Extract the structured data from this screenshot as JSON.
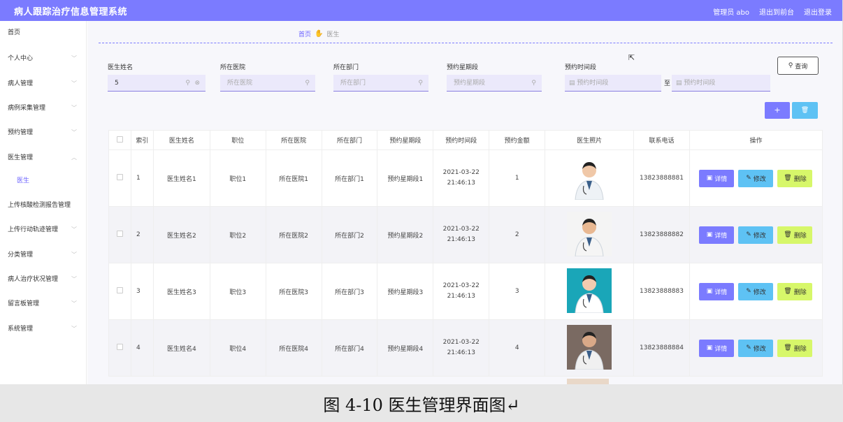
{
  "app_title": "病人跟踪治疗信息管理系统",
  "header_links": [
    "管理员 abo",
    "退出到前台",
    "退出登录"
  ],
  "sidebar": [
    {
      "label": "首页",
      "chevron": false
    },
    {
      "label": "个人中心",
      "chevron": true
    },
    {
      "label": "病人管理",
      "chevron": true
    },
    {
      "label": "病例采集管理",
      "chevron": true
    },
    {
      "label": "预约管理",
      "chevron": true
    },
    {
      "label": "医生管理",
      "chevron": true,
      "open": true
    },
    {
      "label": "医生",
      "sub": true
    },
    {
      "label": "上传核酸检测报告管理",
      "chevron": false
    },
    {
      "label": "上传行动轨迹管理",
      "chevron": true
    },
    {
      "label": "分类管理",
      "chevron": true
    },
    {
      "label": "病人治疗状况管理",
      "chevron": true
    },
    {
      "label": "留言板管理",
      "chevron": true
    },
    {
      "label": "系统管理",
      "chevron": true
    }
  ],
  "breadcrumb": {
    "home": "首页",
    "current": "医生"
  },
  "filters": [
    {
      "label": "医生姓名",
      "value": "5",
      "placeholder": ""
    },
    {
      "label": "所在医院",
      "value": "",
      "placeholder": "所在医院"
    },
    {
      "label": "所在部门",
      "value": "",
      "placeholder": "所在部门"
    },
    {
      "label": "预约星期段",
      "value": "",
      "placeholder": "预约星期段"
    },
    {
      "label": "预约时间段",
      "value": "",
      "placeholder": "预约时间段"
    }
  ],
  "range_to": "至",
  "range_end_placeholder": "预约时间段",
  "query_button": "查询",
  "add_button": "+",
  "columns": [
    "索引",
    "医生姓名",
    "职位",
    "所在医院",
    "所在部门",
    "预约星期段",
    "预约时间段",
    "预约金额",
    "医生照片",
    "联系电话",
    "操作"
  ],
  "rows": [
    {
      "index": "1",
      "name": "医生姓名1",
      "position": "职位1",
      "hospital": "所在医院1",
      "dept": "所在部门1",
      "weekday": "预约星期段1",
      "time": "2021-03-22 21:46:13",
      "amount": "1",
      "phone": "13823888881"
    },
    {
      "index": "2",
      "name": "医生姓名2",
      "position": "职位2",
      "hospital": "所在医院2",
      "dept": "所在部门2",
      "weekday": "预约星期段2",
      "time": "2021-03-22 21:46:13",
      "amount": "2",
      "phone": "13823888882"
    },
    {
      "index": "3",
      "name": "医生姓名3",
      "position": "职位3",
      "hospital": "所在医院3",
      "dept": "所在部门3",
      "weekday": "预约星期段3",
      "time": "2021-03-22 21:46:13",
      "amount": "3",
      "phone": "13823888883"
    },
    {
      "index": "4",
      "name": "医生姓名4",
      "position": "职位4",
      "hospital": "所在医院4",
      "dept": "所在部门4",
      "weekday": "预约星期段4",
      "time": "2021-03-22 21:46:13",
      "amount": "4",
      "phone": "13823888884"
    }
  ],
  "row_actions": {
    "detail": "详情",
    "edit": "修改",
    "delete": "删除"
  },
  "caption": "图 4-10 医生管理界面图↵"
}
